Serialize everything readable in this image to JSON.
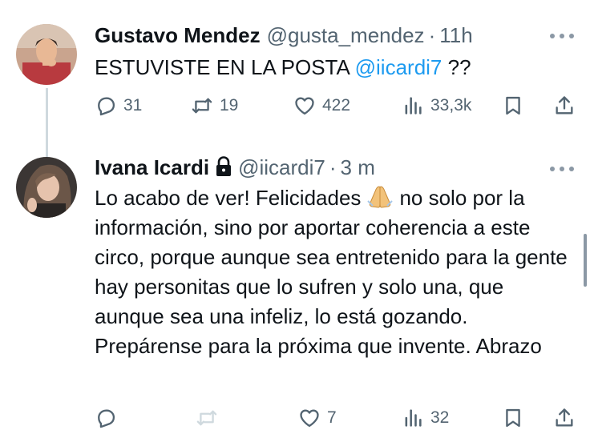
{
  "tweets": [
    {
      "display_name": "Gustavo Mendez",
      "handle": "@gusta_mendez",
      "separator": "·",
      "time": "11h",
      "text_before": "ESTUVISTE EN LA POSTA ",
      "mention": "@iicardi7",
      "text_after": " ??",
      "reply_count": "31",
      "retweet_count": "19",
      "like_count": "422",
      "view_count": "33,3k"
    },
    {
      "display_name": "Ivana Icardi",
      "protected_icon": "lock-icon",
      "handle": "@iicardi7",
      "separator": "·",
      "time": "3 m",
      "text_part1": "Lo acabo de ver! Felicidades",
      "emoji": "folded-hands-emoji",
      "text_part2": "no solo por la información, sino por aportar coherencia a este circo, porque aunque sea entretenido para la gente hay personitas que lo sufren y solo una, que aunque sea una infeliz, lo está gozando. Prepárense para la próxima que invente. Abrazo",
      "reply_count": "",
      "retweet_count": "",
      "like_count": "7",
      "view_count": "32"
    }
  ],
  "icons": [
    "more-icon",
    "reply-icon",
    "retweet-icon",
    "like-icon",
    "views-icon",
    "bookmark-icon",
    "share-icon"
  ],
  "colors": {
    "text": "#0f1419",
    "secondary": "#536471",
    "mention": "#1d9bf0",
    "thread_line": "#cfd9de",
    "disabled": "#cfd9de"
  }
}
